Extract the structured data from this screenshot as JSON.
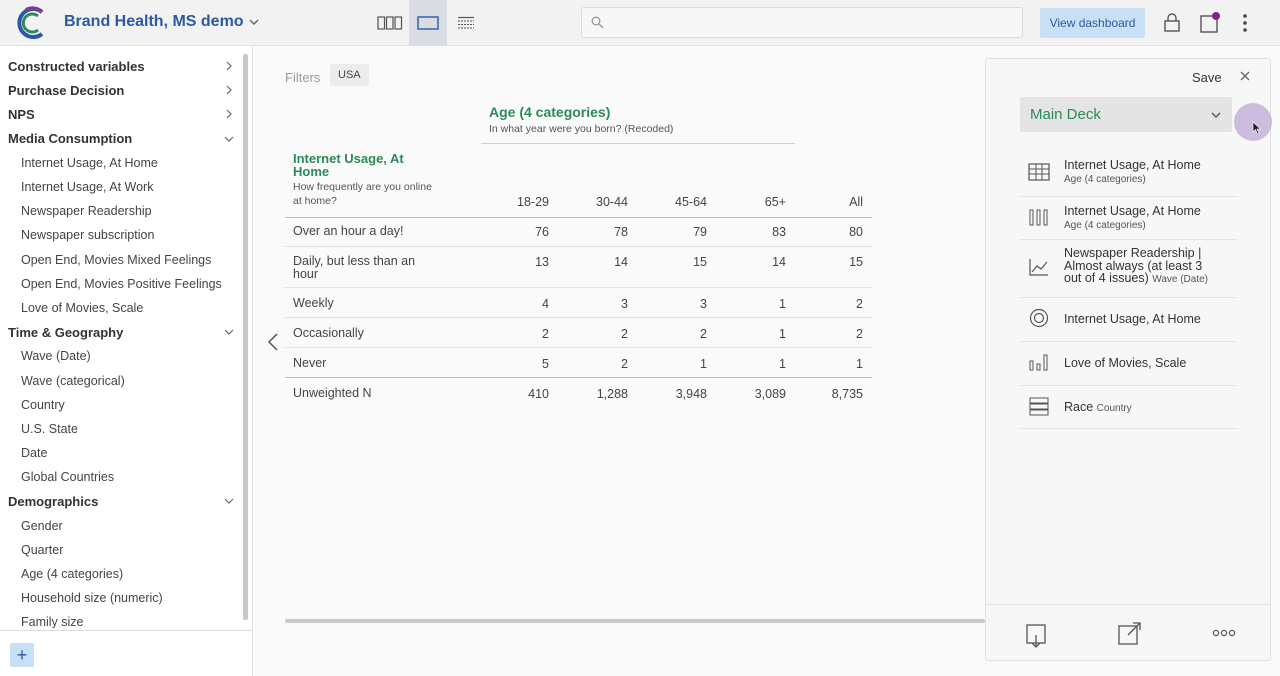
{
  "header": {
    "app_title": "Brand Health, MS demo",
    "search": {
      "placeholder": "",
      "value": ""
    },
    "view_dashboard_label": "View dashboard",
    "icons": [
      "logo-icon",
      "chevron-down-icon",
      "grid-view-icon",
      "single-view-icon",
      "list-view-icon",
      "search-icon",
      "lock-icon",
      "notification-icon",
      "more-vert-icon"
    ]
  },
  "sidebar": {
    "groups": [
      {
        "label": "Constructed variables",
        "expanded": false,
        "items": []
      },
      {
        "label": "Purchase Decision",
        "expanded": false,
        "items": []
      },
      {
        "label": "NPS",
        "expanded": false,
        "items": []
      },
      {
        "label": "Media Consumption",
        "expanded": true,
        "items": [
          "Internet Usage, At Home",
          "Internet Usage, At Work",
          "Newspaper Readership",
          "Newspaper subscription",
          "Open End, Movies Mixed Feelings",
          "Open End, Movies Positive Feelings",
          "Love of Movies, Scale"
        ]
      },
      {
        "label": "Time & Geography",
        "expanded": true,
        "items": [
          "Wave (Date)",
          "Wave (categorical)",
          "Country",
          "U.S. State",
          "Date",
          "Global Countries"
        ]
      },
      {
        "label": "Demographics",
        "expanded": true,
        "items": [
          "Gender",
          "Quarter",
          "Age (4 categories)",
          "Household size (numeric)",
          "Family size"
        ]
      }
    ],
    "add_label": "+"
  },
  "main": {
    "filters_label": "Filters",
    "filter_chip": "USA",
    "column_variable": {
      "title": "Age (4 categories)",
      "question": "In what year were you born? (Recoded)"
    },
    "row_variable": {
      "title": "Internet Usage, At Home",
      "question": "How frequently are you online at home?"
    },
    "table": {
      "columns": [
        "18-29",
        "30-44",
        "45-64",
        "65+",
        "All"
      ],
      "rows": [
        {
          "label": "Over an hour a day!",
          "values": [
            "76",
            "78",
            "79",
            "83",
            "80"
          ]
        },
        {
          "label": "Daily, but less than an hour",
          "values": [
            "13",
            "14",
            "15",
            "14",
            "15"
          ]
        },
        {
          "label": "Weekly",
          "values": [
            "4",
            "3",
            "3",
            "1",
            "2"
          ]
        },
        {
          "label": "Occasionally",
          "values": [
            "2",
            "2",
            "2",
            "1",
            "2"
          ]
        },
        {
          "label": "Never",
          "values": [
            "5",
            "2",
            "1",
            "1",
            "1"
          ]
        },
        {
          "label": "Unweighted N",
          "values": [
            "410",
            "1,288",
            "3,948",
            "3,089",
            "8,735"
          ]
        }
      ]
    }
  },
  "deck_panel": {
    "save_label": "Save",
    "deck_name": "Main Deck",
    "items": [
      {
        "icon": "table-icon",
        "title": "Internet Usage, At Home",
        "subtitle": "Age (4 categories)"
      },
      {
        "icon": "grouped-bar-icon",
        "title": "Internet Usage, At Home",
        "subtitle": "Age (4 categories)"
      },
      {
        "icon": "line-chart-icon",
        "title": "Newspaper Readership | Almost always (at least 3 out of 4 issues)",
        "subtitle": "Wave (Date)"
      },
      {
        "icon": "donut-icon",
        "title": "Internet Usage, At Home",
        "subtitle": ""
      },
      {
        "icon": "bar-chart-icon",
        "title": "Love of Movies, Scale",
        "subtitle": ""
      },
      {
        "icon": "stacked-list-icon",
        "title": "Race",
        "subtitle": "Country"
      }
    ],
    "footer_icons": [
      "download-icon",
      "export-icon",
      "more-horiz-icon"
    ]
  }
}
